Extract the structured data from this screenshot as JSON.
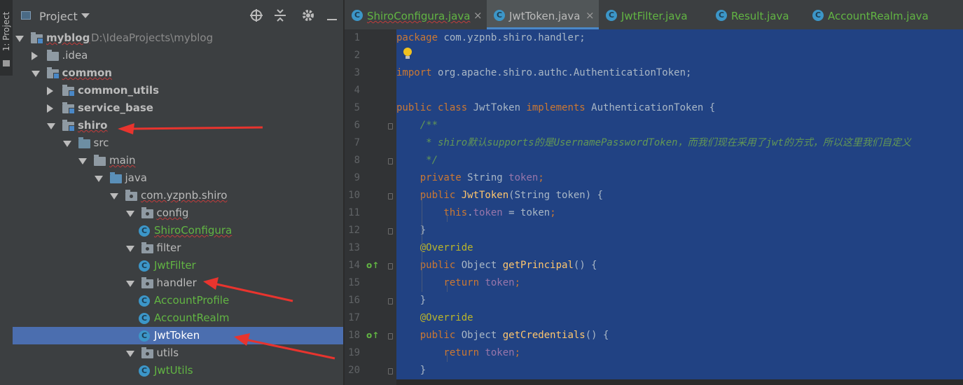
{
  "side_strip": {
    "label": "1: Project"
  },
  "project_panel": {
    "title": "Project",
    "tree": [
      {
        "label": "myblog",
        "path": "D:\\IdeaProjects\\myblog",
        "depth": 0,
        "expanded": true,
        "kind": "module",
        "bold": true,
        "selected": false
      },
      {
        "label": ".idea",
        "depth": 1,
        "expanded": false,
        "kind": "folder",
        "bold": false,
        "selected": false
      },
      {
        "label": "common",
        "depth": 1,
        "expanded": true,
        "kind": "module",
        "bold": true,
        "selected": false
      },
      {
        "label": "common_utils",
        "depth": 2,
        "expanded": false,
        "kind": "module",
        "bold": true,
        "selected": false
      },
      {
        "label": "service_base",
        "depth": 2,
        "expanded": false,
        "kind": "module",
        "bold": true,
        "selected": false
      },
      {
        "label": "shiro",
        "depth": 2,
        "expanded": true,
        "kind": "module",
        "bold": true,
        "selected": false
      },
      {
        "label": "src",
        "depth": 3,
        "expanded": true,
        "kind": "folder",
        "bold": false,
        "selected": false
      },
      {
        "label": "main",
        "depth": 4,
        "expanded": true,
        "kind": "folder",
        "bold": false,
        "selected": false
      },
      {
        "label": "java",
        "depth": 5,
        "expanded": true,
        "kind": "java",
        "bold": false,
        "selected": false
      },
      {
        "label": "com.yzpnb.shiro",
        "depth": 6,
        "expanded": true,
        "kind": "package",
        "bold": false,
        "selected": false
      },
      {
        "label": "config",
        "depth": 7,
        "expanded": true,
        "kind": "package",
        "bold": false,
        "selected": false
      },
      {
        "label": "ShiroConfigura",
        "depth": 8,
        "kind": "class",
        "bold": false,
        "selected": false
      },
      {
        "label": "filter",
        "depth": 7,
        "expanded": true,
        "kind": "package",
        "bold": false,
        "selected": false
      },
      {
        "label": "JwtFilter",
        "depth": 8,
        "kind": "class",
        "bold": false,
        "selected": false
      },
      {
        "label": "handler",
        "depth": 7,
        "expanded": true,
        "kind": "package",
        "bold": false,
        "selected": false
      },
      {
        "label": "AccountProfile",
        "depth": 8,
        "kind": "class",
        "bold": false,
        "selected": false
      },
      {
        "label": "AccountRealm",
        "depth": 8,
        "kind": "class",
        "bold": false,
        "selected": false
      },
      {
        "label": "JwtToken",
        "depth": 8,
        "kind": "class",
        "bold": false,
        "selected": true
      },
      {
        "label": "utils",
        "depth": 7,
        "expanded": true,
        "kind": "package",
        "bold": false,
        "selected": false
      },
      {
        "label": "JwtUtils",
        "depth": 8,
        "kind": "class",
        "bold": false,
        "selected": false
      }
    ]
  },
  "editor_tabs": [
    {
      "label": "ShiroConfigura.java",
      "active": false,
      "error": true
    },
    {
      "label": "JwtToken.java",
      "active": true,
      "error": false
    },
    {
      "label": "JwtFilter.java",
      "active": false,
      "error": false
    },
    {
      "label": "Result.java",
      "active": false,
      "error": false
    },
    {
      "label": "AccountRealm.java",
      "active": false,
      "error": false
    }
  ],
  "line_numbers": [
    "1",
    "2",
    "3",
    "4",
    "5",
    "6",
    "7",
    "8",
    "9",
    "10",
    "11",
    "12",
    "13",
    "14",
    "15",
    "16",
    "17",
    "18",
    "19",
    "20"
  ],
  "code_lines": [
    [
      [
        "kw",
        "package "
      ],
      [
        "",
        "com.yzpnb.shiro.handler;"
      ]
    ],
    [],
    [
      [
        "kw",
        "import "
      ],
      [
        "",
        "org.apache.shiro.authc.AuthenticationToken;"
      ]
    ],
    [],
    [
      [
        "kw",
        "public class "
      ],
      [
        "",
        "JwtToken "
      ],
      [
        "kw",
        "implements "
      ],
      [
        "",
        "AuthenticationToken {"
      ]
    ],
    [
      [
        "doc",
        "    /**"
      ]
    ],
    [
      [
        "doc",
        "     * shiro默认supports的是UsernamePasswordToken，而我们现在采用了jwt的方式，所以这里我们自定义"
      ]
    ],
    [
      [
        "doc",
        "     */"
      ]
    ],
    [
      [
        "kw",
        "    private "
      ],
      [
        "",
        "String "
      ],
      [
        "fld",
        "token"
      ],
      [
        "kw",
        ";"
      ]
    ],
    [
      [
        "kw",
        "    public "
      ],
      [
        "fn",
        "JwtToken"
      ],
      [
        "",
        "(String token) {"
      ]
    ],
    [
      [
        "kw",
        "        this"
      ],
      [
        "",
        "."
      ],
      [
        "fld",
        "token"
      ],
      [
        "",
        " = token"
      ],
      [
        "kw",
        ";"
      ]
    ],
    [
      [
        "",
        "    }"
      ]
    ],
    [
      [
        "ann",
        "    @Override"
      ]
    ],
    [
      [
        "kw",
        "    public "
      ],
      [
        "",
        "Object "
      ],
      [
        "fn",
        "getPrincipal"
      ],
      [
        "",
        "() {"
      ]
    ],
    [
      [
        "kw",
        "        return "
      ],
      [
        "fld",
        "token"
      ],
      [
        "kw",
        ";"
      ]
    ],
    [
      [
        "",
        "    }"
      ]
    ],
    [
      [
        "ann",
        "    @Override"
      ]
    ],
    [
      [
        "kw",
        "    public "
      ],
      [
        "",
        "Object "
      ],
      [
        "fn",
        "getCredentials"
      ],
      [
        "",
        "() {"
      ]
    ],
    [
      [
        "kw",
        "        return "
      ],
      [
        "fld",
        "token"
      ],
      [
        "kw",
        ";"
      ]
    ],
    [
      [
        "",
        "    }"
      ]
    ]
  ],
  "gutter_markers": {
    "implements_lines": [
      "14",
      "18"
    ],
    "implements_icon": "implementing-method-icon"
  },
  "colors": {
    "selection": "#214283",
    "tree_selection": "#4b6eaf",
    "annotation_arrow": "#e8342e",
    "class_green": "#62b543"
  }
}
